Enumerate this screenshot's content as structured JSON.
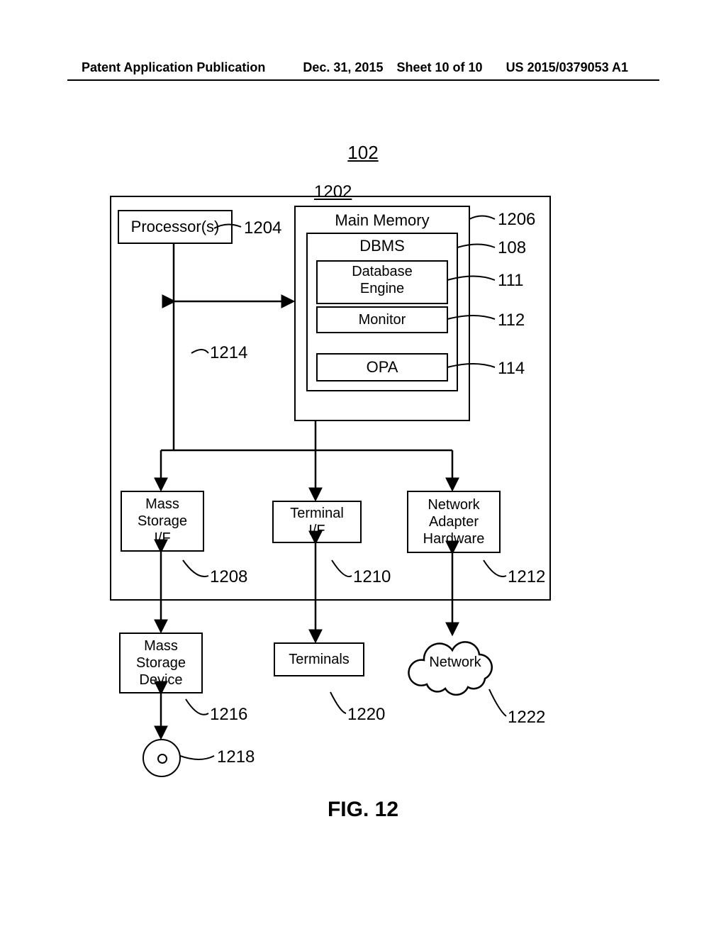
{
  "header": {
    "left": "Patent Application Publication",
    "date": "Dec. 31, 2015",
    "sheet": "Sheet 10 of 10",
    "number": "US 2015/0379053 A1"
  },
  "refs": {
    "r102": "102",
    "r1202": "1202",
    "r1204": "1204",
    "r1206": "1206",
    "r108": "108",
    "r111": "111",
    "r112": "112",
    "r114": "114",
    "r1214": "1214",
    "r1208": "1208",
    "r1210": "1210",
    "r1212": "1212",
    "r1216": "1216",
    "r1218": "1218",
    "r1220": "1220",
    "r1222": "1222"
  },
  "boxes": {
    "processor": "Processor(s)",
    "main_memory": "Main Memory",
    "dbms": "DBMS",
    "db_engine": "Database\nEngine",
    "monitor": "Monitor",
    "opa": "OPA",
    "mass_if": "Mass\nStorage\nI/F",
    "term_if": "Terminal\nI/F",
    "net_hw": "Network\nAdapter\nHardware",
    "mass_dev": "Mass\nStorage\nDevice",
    "terminals": "Terminals",
    "network": "Network"
  },
  "figure_caption": "FIG. 12"
}
